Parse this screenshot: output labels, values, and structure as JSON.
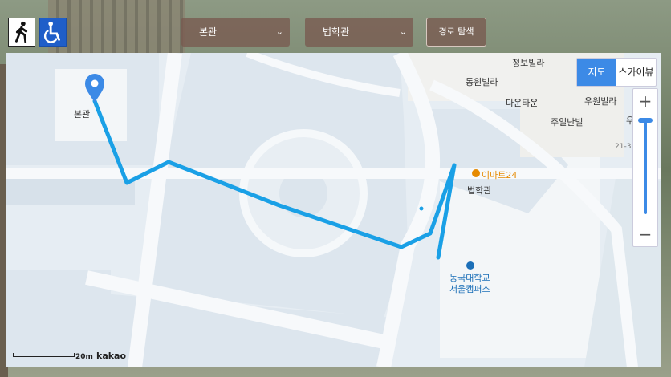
{
  "modes": {
    "walk_icon": "walking-person-icon",
    "wheelchair_icon": "wheelchair-icon"
  },
  "route_form": {
    "from": "본관",
    "to": "법학관",
    "search_label": "경로 탐색"
  },
  "map": {
    "type_map_label": "지도",
    "type_sky_label": "스카이뷰",
    "zoom_in": "+",
    "zoom_out": "−",
    "labels": {
      "bongwan": "본관",
      "beophakgwan": "법학관",
      "emart": "이마트24",
      "campus_line1": "동국대학교",
      "campus_line2": "서울캠퍼스",
      "jeongbo": "정보빌라",
      "dongwon": "동원빌라",
      "dawoon": "다운타운",
      "wuwon": "우원빌라",
      "juil": "주일난빌",
      "addr": "21-3",
      "partial": "우"
    },
    "scale_text": "20m",
    "brand": "kakao",
    "colors": {
      "route": "#1aa0e6",
      "marker": "#3c8ae6",
      "map_toggle_active": "#3c8ae6"
    }
  }
}
